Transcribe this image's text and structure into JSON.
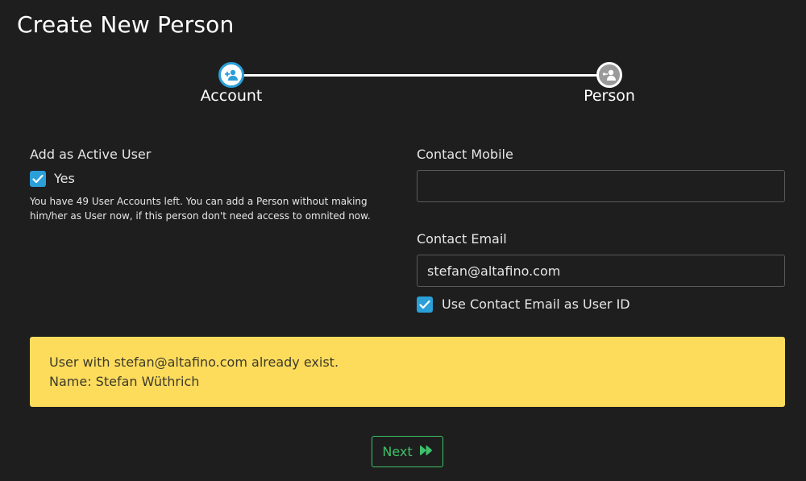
{
  "page": {
    "title": "Create New Person"
  },
  "stepper": {
    "steps": [
      {
        "label": "Account",
        "icon": "add-user-icon",
        "state": "active"
      },
      {
        "label": "Person",
        "icon": "share-user-icon",
        "state": "inactive"
      }
    ],
    "colors": {
      "active": "#2a9fd8",
      "inactive": "#9a9a9a"
    }
  },
  "left": {
    "active_user_label": "Add as Active User",
    "active_user_checkbox": {
      "checked": true,
      "label": "Yes"
    },
    "help_text": "You have 49 User Accounts left. You can add a Person without making him/her as User now, if this person don't need access to omnited now."
  },
  "right": {
    "mobile": {
      "label": "Contact Mobile",
      "value": ""
    },
    "email": {
      "label": "Contact Email",
      "value": "stefan@altafino.com"
    },
    "use_email_checkbox": {
      "checked": true,
      "label": "Use Contact Email as User ID"
    }
  },
  "alert": {
    "line1": "User with stefan@altafino.com already exist.",
    "line2": "Name: Stefan Wüthrich",
    "color": "#fddc5c"
  },
  "footer": {
    "next_label": "Next",
    "next_icon": "fast-forward-icon",
    "color": "#3fbf6a"
  }
}
